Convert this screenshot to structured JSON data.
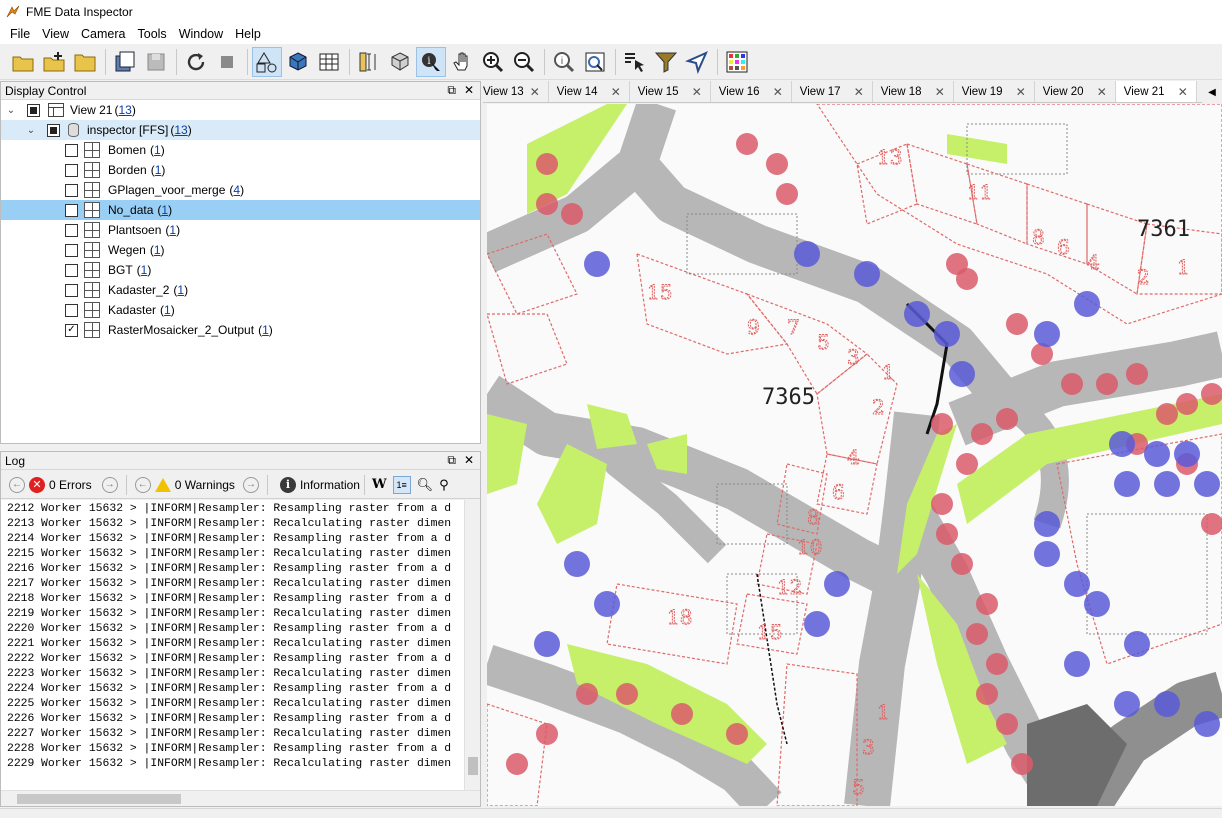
{
  "window": {
    "title": "FME Data Inspector"
  },
  "menu": [
    "File",
    "View",
    "Camera",
    "Tools",
    "Window",
    "Help"
  ],
  "toolbar": {
    "icons": [
      "open-folder-icon",
      "add-folder-icon",
      "folder-icon",
      "save-icon",
      "save-disabled-icon",
      "refresh-icon",
      "stop-icon",
      "select-shapes-icon",
      "3d-view-icon",
      "table-view-icon",
      "measure-icon",
      "extrude-icon",
      "inspect-icon",
      "pan-icon",
      "zoom-in-icon",
      "zoom-out-icon",
      "query-icon",
      "zoom-extents-icon",
      "select-icon",
      "filter-icon",
      "navigate-icon",
      "color-grid-icon"
    ]
  },
  "display_control": {
    "title": "Display Control",
    "root": {
      "label": "View 21",
      "count": "13"
    },
    "dataset": {
      "label": "inspector [FFS]",
      "count": "13"
    },
    "layers": [
      {
        "label": "Bomen",
        "count": "1",
        "checked": false
      },
      {
        "label": "Borden",
        "count": "1",
        "checked": false
      },
      {
        "label": "GPlagen_voor_merge",
        "count": "4",
        "checked": false
      },
      {
        "label": "No_data",
        "count": "1",
        "checked": false
      },
      {
        "label": "Plantsoen",
        "count": "1",
        "checked": false
      },
      {
        "label": "Wegen",
        "count": "1",
        "checked": false
      },
      {
        "label": "BGT",
        "count": "1",
        "checked": false
      },
      {
        "label": "Kadaster_2",
        "count": "1",
        "checked": false
      },
      {
        "label": "Kadaster",
        "count": "1",
        "checked": false
      },
      {
        "label": "RasterMosaicker_2_Output",
        "count": "1",
        "checked": true
      }
    ]
  },
  "log": {
    "title": "Log",
    "errors": "0 Errors",
    "warnings": "0 Warnings",
    "information": "Information",
    "lines": [
      {
        "n": "2212",
        "text": "Worker 15632 > |INFORM|Resampler: Resampling raster from a d"
      },
      {
        "n": "2213",
        "text": "Worker 15632 > |INFORM|Resampler: Recalculating raster dimen"
      },
      {
        "n": "2214",
        "text": "Worker 15632 > |INFORM|Resampler: Resampling raster from a d"
      },
      {
        "n": "2215",
        "text": "Worker 15632 > |INFORM|Resampler: Recalculating raster dimen"
      },
      {
        "n": "2216",
        "text": "Worker 15632 > |INFORM|Resampler: Resampling raster from a d"
      },
      {
        "n": "2217",
        "text": "Worker 15632 > |INFORM|Resampler: Recalculating raster dimen"
      },
      {
        "n": "2218",
        "text": "Worker 15632 > |INFORM|Resampler: Resampling raster from a d"
      },
      {
        "n": "2219",
        "text": "Worker 15632 > |INFORM|Resampler: Recalculating raster dimen"
      },
      {
        "n": "2220",
        "text": "Worker 15632 > |INFORM|Resampler: Resampling raster from a d"
      },
      {
        "n": "2221",
        "text": "Worker 15632 > |INFORM|Resampler: Recalculating raster dimen"
      },
      {
        "n": "2222",
        "text": "Worker 15632 > |INFORM|Resampler: Resampling raster from a d"
      },
      {
        "n": "2223",
        "text": "Worker 15632 > |INFORM|Resampler: Recalculating raster dimen"
      },
      {
        "n": "2224",
        "text": "Worker 15632 > |INFORM|Resampler: Resampling raster from a d"
      },
      {
        "n": "2225",
        "text": "Worker 15632 > |INFORM|Resampler: Recalculating raster dimen"
      },
      {
        "n": "2226",
        "text": "Worker 15632 > |INFORM|Resampler: Resampling raster from a d"
      },
      {
        "n": "2227",
        "text": "Worker 15632 > |INFORM|Resampler: Recalculating raster dimen"
      },
      {
        "n": "2228",
        "text": "Worker 15632 > |INFORM|Resampler: Resampling raster from a d"
      },
      {
        "n": "2229",
        "text": "Worker 15632 > |INFORM|Resampler: Recalculating raster dimen"
      }
    ]
  },
  "tabs": [
    {
      "label": "View 13",
      "active": false
    },
    {
      "label": "View 14",
      "active": false
    },
    {
      "label": "View 15",
      "active": false
    },
    {
      "label": "View 16",
      "active": false
    },
    {
      "label": "View 17",
      "active": false
    },
    {
      "label": "View 18",
      "active": false
    },
    {
      "label": "View 19",
      "active": false
    },
    {
      "label": "View 20",
      "active": false
    },
    {
      "label": "View 21",
      "active": true
    }
  ],
  "map": {
    "parcel_labels": [
      "7361",
      "7365"
    ],
    "house_numbers": [
      "13",
      "11",
      "8",
      "6",
      "4",
      "2",
      "1",
      "15",
      "9",
      "7",
      "5",
      "3",
      "1",
      "2",
      "4",
      "6",
      "8",
      "10",
      "12",
      "18",
      "15",
      "1",
      "3",
      "5"
    ],
    "colors": {
      "road": "#b9b9b9",
      "green": "#c6f06a",
      "tree_red": "#d95a6a",
      "tree_blue": "#5a5ad8",
      "parcel_line": "#e06060"
    }
  }
}
